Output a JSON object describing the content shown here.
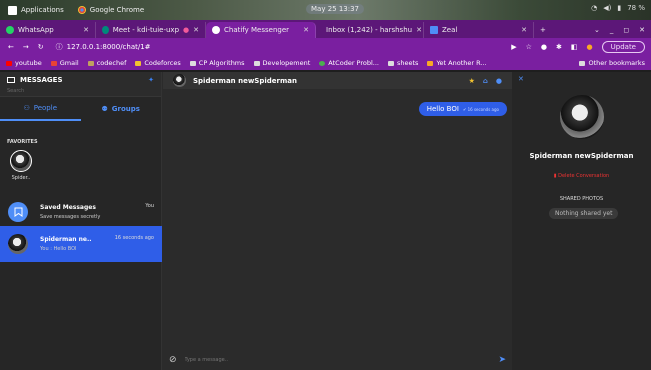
{
  "os": {
    "applications": "Applications",
    "chrome": "Google Chrome",
    "clock": "May 25  13:37",
    "battery": "78 %"
  },
  "browser": {
    "tabs": [
      {
        "label": "WhatsApp",
        "color": "#25d366"
      },
      {
        "label": "Meet - kdi-tuie-uxp",
        "color": "#00897b"
      },
      {
        "label": "Chatify Messenger",
        "color": "#ffffff"
      },
      {
        "label": "Inbox (1,242) - harshshu",
        "color": "#ea4335"
      },
      {
        "label": "Zeal",
        "color": "#4f8ef7"
      }
    ],
    "url": "127.0.0.1:8000/chat/1#",
    "update_label": "Update",
    "bookmarks": [
      "youtube",
      "Gmail",
      "codechef",
      "Codeforces",
      "CP Algorithms",
      "Developement",
      "AtCoder Probl...",
      "sheets",
      "Yet Another R..."
    ],
    "other_bookmarks": "Other bookmarks"
  },
  "sidebar": {
    "title": "MESSAGES",
    "search_placeholder": "Search",
    "tab_people": "People",
    "tab_groups": "Groups",
    "favorites_label": "FAVORITES",
    "favorite_name": "Spider..",
    "saved": {
      "name": "Saved Messages",
      "preview": "Save messages secretly",
      "time": "You"
    },
    "active_conv": {
      "name": "Spiderman ne..",
      "preview": "You : Hello BOI",
      "time": "16 seconds ago"
    }
  },
  "chat": {
    "contact_name": "Spiderman newSpiderman",
    "message_text": "Hello BOI",
    "message_status": "✔ 16 seconds ago",
    "input_placeholder": "Type a message.."
  },
  "panel": {
    "name": "Spiderman newSpiderman",
    "delete_label": "Delete Conversation",
    "shared_label": "SHARED PHOTOS",
    "nothing_shared": "Nothing shared yet"
  },
  "colors": {
    "accent": "#2f5ee8",
    "chrome_purple": "#7a1fa0",
    "delete_red": "#e33333"
  }
}
